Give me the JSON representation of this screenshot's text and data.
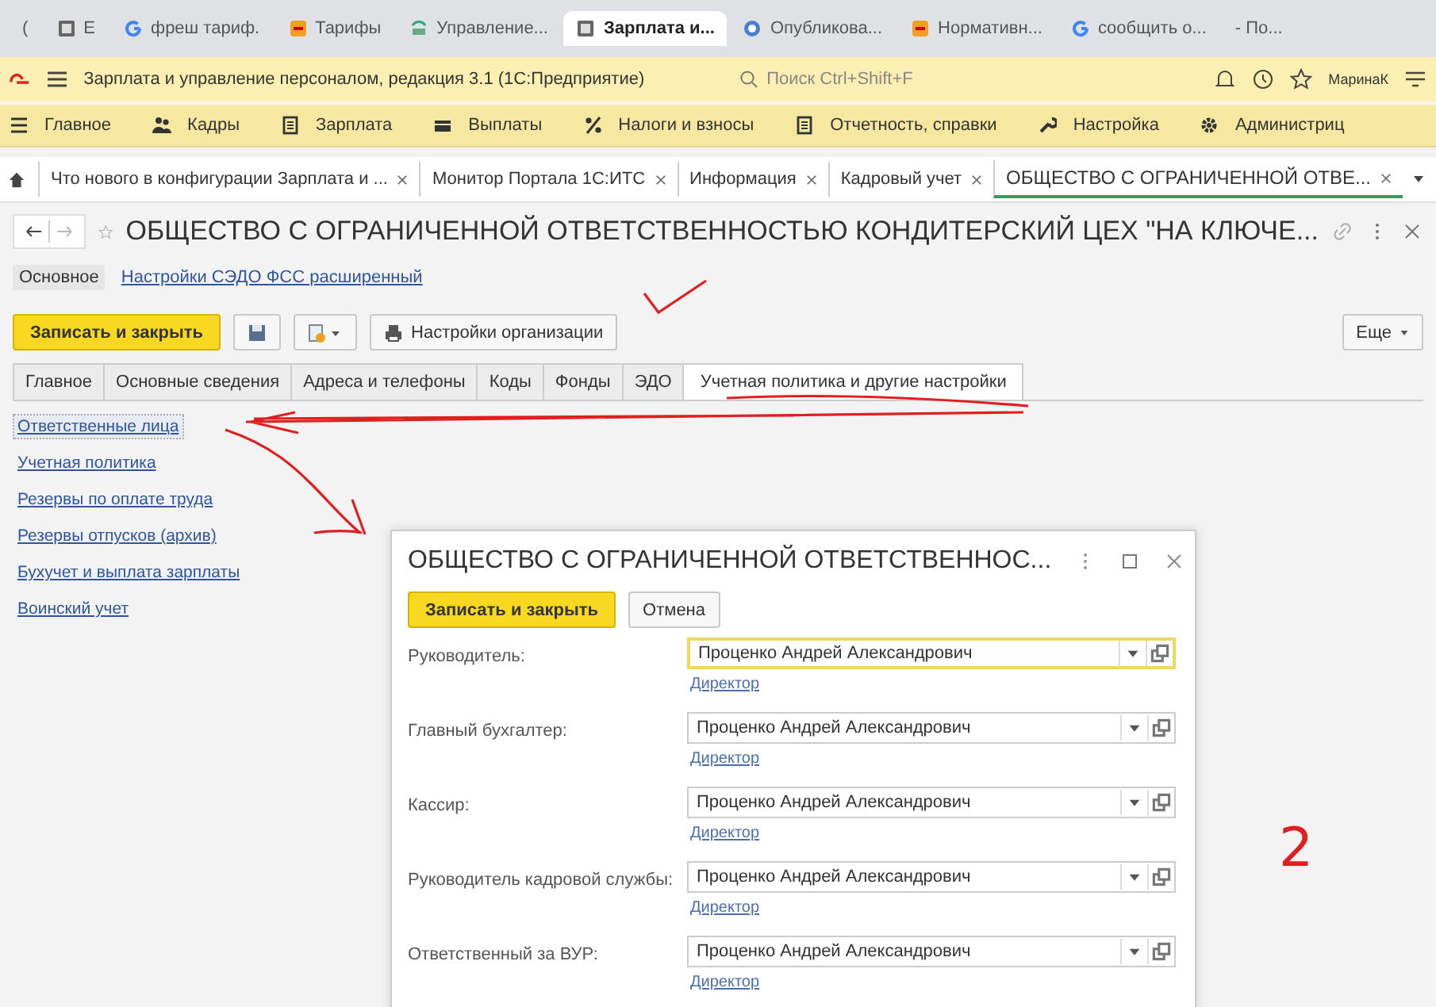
{
  "browser_tabs": [
    {
      "label": "(",
      "kind": "none",
      "selected": false
    },
    {
      "label": "E",
      "kind": "square",
      "selected": false
    },
    {
      "label": "фреш тариф.",
      "kind": "g",
      "selected": false
    },
    {
      "label": "Тарифы",
      "kind": "orange",
      "selected": false
    },
    {
      "label": "Управление...",
      "kind": "sc",
      "selected": false
    },
    {
      "label": "Зарплата и...",
      "kind": "square",
      "selected": true
    },
    {
      "label": "Опубликова...",
      "kind": "circle",
      "selected": false
    },
    {
      "label": "Нормативн...",
      "kind": "orange",
      "selected": false
    },
    {
      "label": "сообщить о...",
      "kind": "g",
      "selected": false
    },
    {
      "label": "- По...",
      "kind": "none",
      "selected": false
    }
  ],
  "app_header": {
    "title": "Зарплата и управление персоналом, редакция 3.1  (1С:Предприятие)",
    "search": {
      "placeholder": "Поиск Ctrl+Shift+F"
    },
    "user": "МаринаК"
  },
  "sections": [
    {
      "label": "Главное",
      "kind": "menu"
    },
    {
      "label": "Кадры",
      "kind": "people"
    },
    {
      "label": "Зарплата",
      "kind": "doc"
    },
    {
      "label": "Выплаты",
      "kind": "card"
    },
    {
      "label": "Налоги и взносы",
      "kind": "percent"
    },
    {
      "label": "Отчетность, справки",
      "kind": "doc"
    },
    {
      "label": "Настройка",
      "kind": "wrench"
    },
    {
      "label": "Администриц",
      "kind": "gear"
    }
  ],
  "open_tabs": [
    {
      "label": "Что нового в конфигурации Зарплата и ...",
      "selected": false
    },
    {
      "label": "Монитор Портала 1С:ИТС",
      "selected": false
    },
    {
      "label": "Информация",
      "selected": false
    },
    {
      "label": "Кадровый учет",
      "selected": false
    },
    {
      "label": "ОБЩЕСТВО С ОГРАНИЧЕННОЙ ОТВЕ...",
      "selected": true
    }
  ],
  "form": {
    "title": "ОБЩЕСТВО С ОГРАНИЧЕННОЙ ОТВЕТСТВЕННОСТЬЮ КОНДИТЕРСКИЙ ЦЕХ \"НА КЛЮЧЕ...",
    "nav": [
      {
        "label": "Основное",
        "selected": true
      },
      {
        "label": "Настройки СЭДО ФСС расширенный",
        "selected": false
      }
    ],
    "save_button": "Записать и закрыть",
    "settings_button": "Настройки организации",
    "more_button": "Еще",
    "tabs": [
      {
        "label": "Главное",
        "selected": false
      },
      {
        "label": "Основные сведения",
        "selected": false
      },
      {
        "label": "Адреса и телефоны",
        "selected": false
      },
      {
        "label": "Коды",
        "selected": false
      },
      {
        "label": "Фонды",
        "selected": false
      },
      {
        "label": "ЭДО",
        "selected": false
      },
      {
        "label": "Учетная политика и другие настройки",
        "selected": true
      }
    ],
    "links": [
      {
        "label": "Ответственные лица",
        "selected": true
      },
      {
        "label": "Учетная политика",
        "selected": false
      },
      {
        "label": "Резервы по оплате труда",
        "selected": false
      },
      {
        "label": "Резервы отпусков (архив)",
        "selected": false
      },
      {
        "label": "Бухучет и выплата зарплаты",
        "selected": false
      },
      {
        "label": "Воинский учет",
        "selected": false
      }
    ]
  },
  "dialog": {
    "title": "ОБЩЕСТВО С ОГРАНИЧЕННОЙ ОТВЕТСТВЕННОС...",
    "save_button": "Записать и закрыть",
    "cancel_button": "Отмена",
    "fields": [
      {
        "label": "Руководитель:",
        "value": "Проценко Андрей Александрович",
        "link": "Директор",
        "focused": true
      },
      {
        "label": "Главный бухгалтер:",
        "value": "Проценко Андрей Александрович",
        "link": "Директор",
        "focused": false
      },
      {
        "label": "Кассир:",
        "value": "Проценко Андрей Александрович",
        "link": "Директор",
        "focused": false
      },
      {
        "label": "Руководитель кадровой службы:",
        "value": "Проценко Андрей Александрович",
        "link": "Директор",
        "focused": false
      },
      {
        "label": "Ответственный за ВУР:",
        "value": "Проценко Андрей Александрович",
        "link": "Директор",
        "focused": false
      }
    ]
  },
  "annotation": {
    "number": "2"
  }
}
